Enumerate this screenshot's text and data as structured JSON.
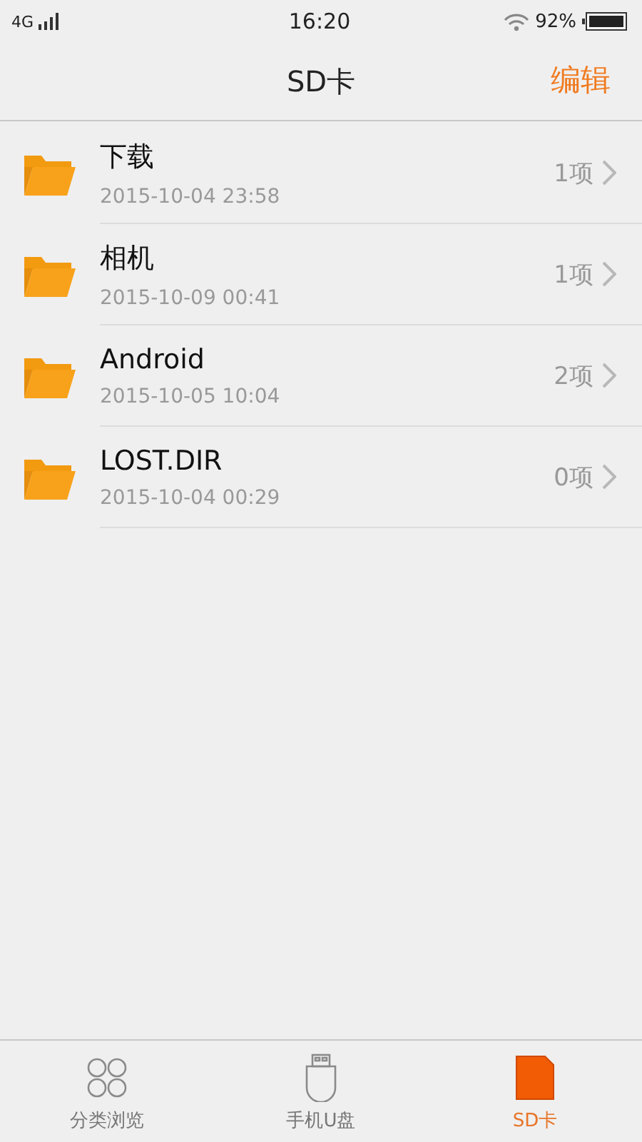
{
  "status_bar": {
    "network": "4G",
    "time": "16:20",
    "battery": "92%"
  },
  "header": {
    "title": "SD卡",
    "action": "编辑"
  },
  "folders": [
    {
      "name": "下载",
      "date": "2015-10-04 23:58",
      "count": "1项"
    },
    {
      "name": "相机",
      "date": "2015-10-09 00:41",
      "count": "1项"
    },
    {
      "name": "Android",
      "date": "2015-10-05 10:04",
      "count": "2项"
    },
    {
      "name": "LOST.DIR",
      "date": "2015-10-04 00:29",
      "count": "0项"
    }
  ],
  "tabs": [
    {
      "kind": "categories",
      "label": "分类浏览",
      "selected": false
    },
    {
      "kind": "usb",
      "label": "手机U盘",
      "selected": false
    },
    {
      "kind": "sdcard",
      "label": "SD卡",
      "selected": true
    }
  ]
}
